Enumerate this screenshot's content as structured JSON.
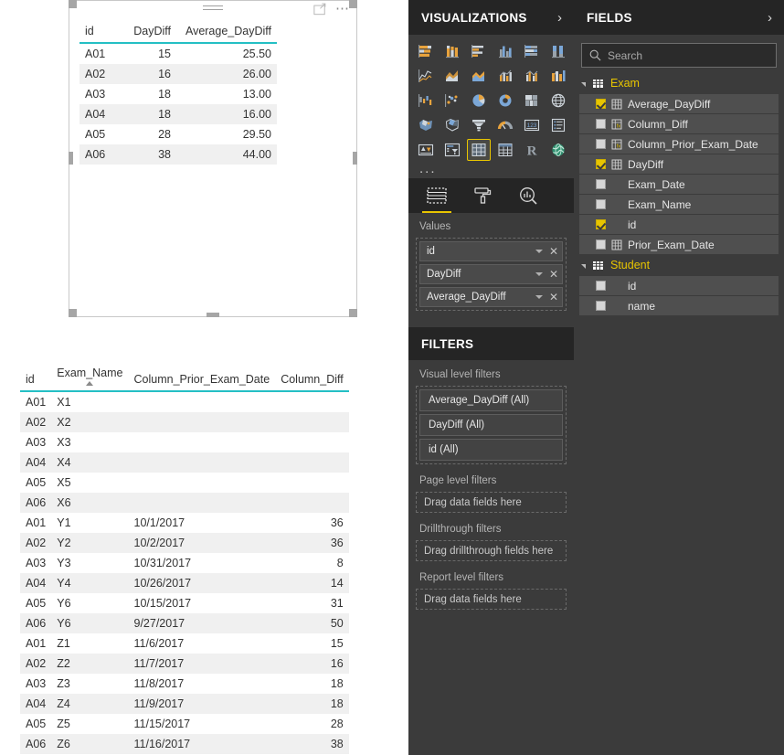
{
  "canvas": {
    "top_visual": {
      "header_icons": [
        "drag-handle",
        "focus-mode-icon",
        "more-options-icon"
      ],
      "table": {
        "columns": [
          {
            "label": "id",
            "align": "left"
          },
          {
            "label": "DayDiff",
            "align": "right"
          },
          {
            "label": "Average_DayDiff",
            "align": "right"
          }
        ],
        "rows": [
          [
            "A01",
            "15",
            "25.50"
          ],
          [
            "A02",
            "16",
            "26.00"
          ],
          [
            "A03",
            "18",
            "13.00"
          ],
          [
            "A04",
            "18",
            "16.00"
          ],
          [
            "A05",
            "28",
            "29.50"
          ],
          [
            "A06",
            "38",
            "44.00"
          ]
        ]
      }
    },
    "bottom_visual": {
      "table": {
        "columns": [
          {
            "label": "id",
            "align": "left",
            "sorted": false
          },
          {
            "label": "Exam_Name",
            "align": "left",
            "sorted": true,
            "sort_direction": "asc"
          },
          {
            "label": "Column_Prior_Exam_Date",
            "align": "left",
            "sorted": false
          },
          {
            "label": "Column_Diff",
            "align": "right",
            "sorted": false
          }
        ],
        "rows": [
          [
            "A01",
            "X1",
            "",
            ""
          ],
          [
            "A02",
            "X2",
            "",
            ""
          ],
          [
            "A03",
            "X3",
            "",
            ""
          ],
          [
            "A04",
            "X4",
            "",
            ""
          ],
          [
            "A05",
            "X5",
            "",
            ""
          ],
          [
            "A06",
            "X6",
            "",
            ""
          ],
          [
            "A01",
            "Y1",
            "10/1/2017",
            "36"
          ],
          [
            "A02",
            "Y2",
            "10/2/2017",
            "36"
          ],
          [
            "A03",
            "Y3",
            "10/31/2017",
            "8"
          ],
          [
            "A04",
            "Y4",
            "10/26/2017",
            "14"
          ],
          [
            "A05",
            "Y6",
            "10/15/2017",
            "31"
          ],
          [
            "A06",
            "Y6",
            "9/27/2017",
            "50"
          ],
          [
            "A01",
            "Z1",
            "11/6/2017",
            "15"
          ],
          [
            "A02",
            "Z2",
            "11/7/2017",
            "16"
          ],
          [
            "A03",
            "Z3",
            "11/8/2017",
            "18"
          ],
          [
            "A04",
            "Z4",
            "11/9/2017",
            "18"
          ],
          [
            "A05",
            "Z5",
            "11/15/2017",
            "28"
          ],
          [
            "A06",
            "Z6",
            "11/16/2017",
            "38"
          ]
        ]
      }
    }
  },
  "visualizations": {
    "title": "VISUALIZATIONS",
    "expand_icon": "chevron-right-icon",
    "gallery": [
      {
        "name": "stacked-bar-chart",
        "selected": false
      },
      {
        "name": "stacked-column-chart",
        "selected": false
      },
      {
        "name": "clustered-bar-chart",
        "selected": false
      },
      {
        "name": "clustered-column-chart",
        "selected": false
      },
      {
        "name": "hundred-percent-stacked-bar-chart",
        "selected": false
      },
      {
        "name": "hundred-percent-stacked-column-chart",
        "selected": false
      },
      {
        "name": "line-chart",
        "selected": false
      },
      {
        "name": "area-chart",
        "selected": false
      },
      {
        "name": "stacked-area-chart",
        "selected": false
      },
      {
        "name": "line-and-stacked-column-chart",
        "selected": false
      },
      {
        "name": "line-and-clustered-column-chart",
        "selected": false
      },
      {
        "name": "ribbon-chart",
        "selected": false
      },
      {
        "name": "waterfall-chart",
        "selected": false
      },
      {
        "name": "scatter-chart",
        "selected": false
      },
      {
        "name": "pie-chart",
        "selected": false
      },
      {
        "name": "donut-chart",
        "selected": false
      },
      {
        "name": "treemap-chart",
        "selected": false
      },
      {
        "name": "map-visual",
        "selected": false
      },
      {
        "name": "filled-map-visual",
        "selected": false
      },
      {
        "name": "shape-map-visual",
        "selected": false
      },
      {
        "name": "funnel-chart",
        "selected": false
      },
      {
        "name": "gauge-chart",
        "selected": false
      },
      {
        "name": "card-visual",
        "selected": false
      },
      {
        "name": "multi-row-card-visual",
        "selected": false
      },
      {
        "name": "kpi-visual",
        "selected": false
      },
      {
        "name": "slicer-visual",
        "selected": false
      },
      {
        "name": "table-visual",
        "selected": true
      },
      {
        "name": "matrix-visual",
        "selected": false
      },
      {
        "name": "r-script-visual",
        "selected": false
      },
      {
        "name": "arcgis-map-visual",
        "selected": false
      }
    ],
    "more_label": "...",
    "tabs": [
      {
        "name": "fields-tab",
        "icon": "fields-icon",
        "active": true
      },
      {
        "name": "format-tab",
        "icon": "paint-roller-icon",
        "active": false
      },
      {
        "name": "analytics-tab",
        "icon": "magnifier-chart-icon",
        "active": false
      }
    ],
    "values_label": "Values",
    "values_fields": [
      {
        "label": "id"
      },
      {
        "label": "DayDiff"
      },
      {
        "label": "Average_DayDiff"
      }
    ]
  },
  "filters": {
    "title": "FILTERS",
    "groups": [
      {
        "label": "Visual level filters",
        "cards": [
          "Average_DayDiff (All)",
          "DayDiff (All)",
          "id (All)"
        ],
        "placeholder": null
      },
      {
        "label": "Page level filters",
        "cards": [],
        "placeholder": "Drag data fields here"
      },
      {
        "label": "Drillthrough filters",
        "cards": [],
        "placeholder": "Drag drillthrough fields here"
      },
      {
        "label": "Report level filters",
        "cards": [],
        "placeholder": "Drag data fields here"
      }
    ]
  },
  "fields": {
    "title": "FIELDS",
    "expand_icon": "chevron-right-icon",
    "search": {
      "value": "",
      "placeholder": "Search",
      "icon": "search-icon"
    },
    "tables": [
      {
        "name": "Exam",
        "expanded": true,
        "fields": [
          {
            "label": "Average_DayDiff",
            "checked": true,
            "icon": "measure-icon"
          },
          {
            "label": "Column_Diff",
            "checked": false,
            "icon": "calculated-column-icon"
          },
          {
            "label": "Column_Prior_Exam_Date",
            "checked": false,
            "icon": "calculated-column-icon"
          },
          {
            "label": "DayDiff",
            "checked": true,
            "icon": "measure-icon"
          },
          {
            "label": "Exam_Date",
            "checked": false,
            "icon": "none"
          },
          {
            "label": "Exam_Name",
            "checked": false,
            "icon": "none"
          },
          {
            "label": "id",
            "checked": true,
            "icon": "none"
          },
          {
            "label": "Prior_Exam_Date",
            "checked": false,
            "icon": "measure-icon"
          }
        ]
      },
      {
        "name": "Student",
        "expanded": true,
        "fields": [
          {
            "label": "id",
            "checked": false,
            "icon": "none"
          },
          {
            "label": "name",
            "checked": false,
            "icon": "none"
          }
        ]
      }
    ]
  },
  "colors": {
    "pane_bg": "#3b3b3b",
    "pane_title_bg": "#252525",
    "accent_yellow": "#e8c500",
    "table_header_rule": "#24bfc4",
    "row_alt": "#f0f0f0",
    "canvas_bg": "#ffffff"
  }
}
